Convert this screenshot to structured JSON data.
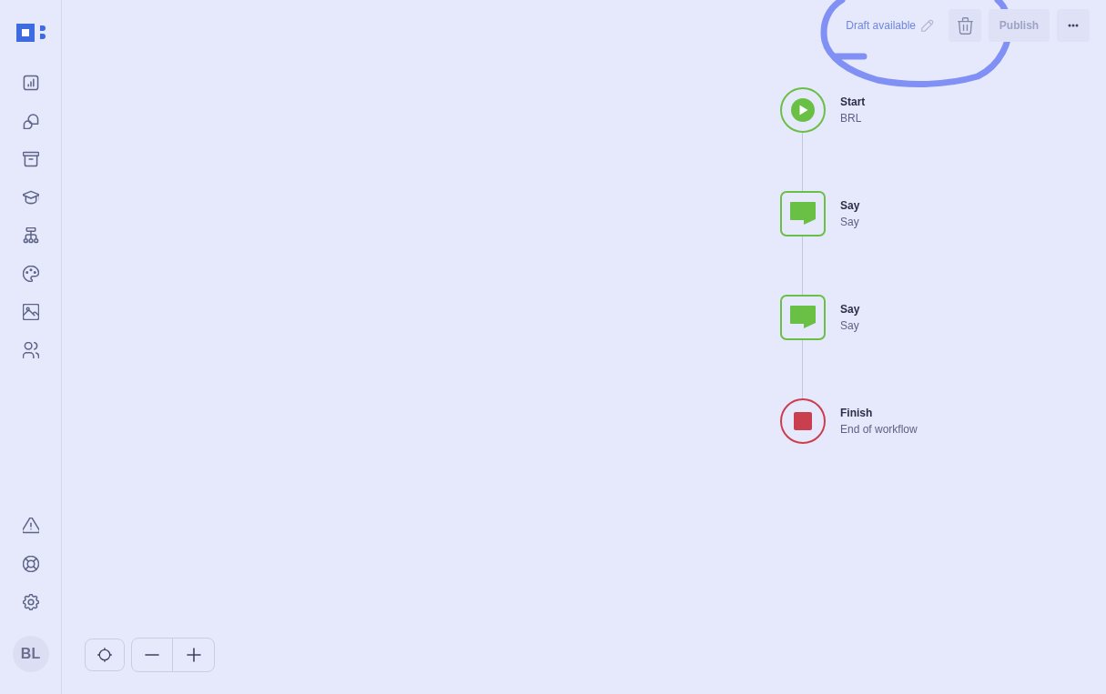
{
  "sidebar": {
    "nav_items": [
      {
        "selected": false
      },
      {
        "selected": false
      },
      {
        "selected": false
      },
      {
        "selected": false
      },
      {
        "selected": false
      },
      {
        "selected": false
      },
      {
        "selected": false
      },
      {
        "selected": false
      }
    ],
    "footer_items": [
      {
        "selected": false
      },
      {
        "selected": false
      },
      {
        "selected": false
      }
    ],
    "avatar": {
      "initials": "BL"
    }
  },
  "toolbar": {
    "draft_status": "Draft available",
    "actions": [
      {
        "kind": "delete",
        "disabled": true
      },
      {
        "kind": "publish",
        "label": "Publish",
        "disabled": true
      },
      {
        "kind": "more",
        "disabled": false
      }
    ]
  },
  "workflow": {
    "nodes": [
      {
        "kind": "start",
        "title": "Start",
        "subtitle": "BRL"
      },
      {
        "kind": "say",
        "title": "Say",
        "subtitle": "Say"
      },
      {
        "kind": "say",
        "title": "Say",
        "subtitle": "Say"
      },
      {
        "kind": "finish",
        "title": "Finish",
        "subtitle": "End of workflow"
      }
    ]
  }
}
